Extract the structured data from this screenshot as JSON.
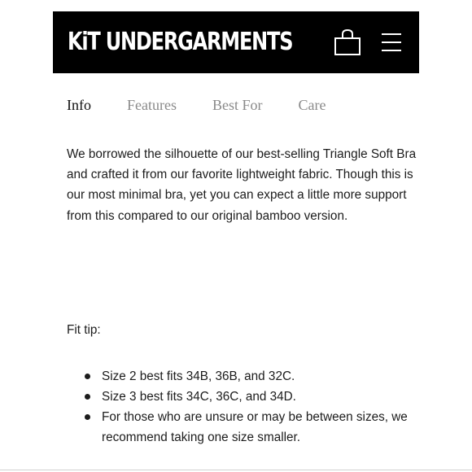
{
  "header": {
    "brand": "KiT UNDERGARMENTS",
    "cart_icon": "shopping-bag-icon",
    "menu_icon": "hamburger-menu-icon",
    "background_color": "#000000",
    "text_color": "#ffffff"
  },
  "tabs": [
    {
      "label": "Info",
      "active": true
    },
    {
      "label": "Features",
      "active": false
    },
    {
      "label": "Best For",
      "active": false
    },
    {
      "label": "Care",
      "active": false
    }
  ],
  "content": {
    "description": "We borrowed the silhouette of our best-selling Triangle Soft Bra and crafted it from our favorite lightweight fabric. Though this is our most minimal bra, yet you can expect a little more support from this compared to our original bamboo version.",
    "fit_label": "Fit tip:",
    "fit_tips": [
      "Size 2 best fits 34B, 36B, and 32C.",
      "Size 3 best fits 34C, 36C, and 34D.",
      "For those who are unsure or may be between sizes, we recommend taking one size smaller."
    ]
  }
}
